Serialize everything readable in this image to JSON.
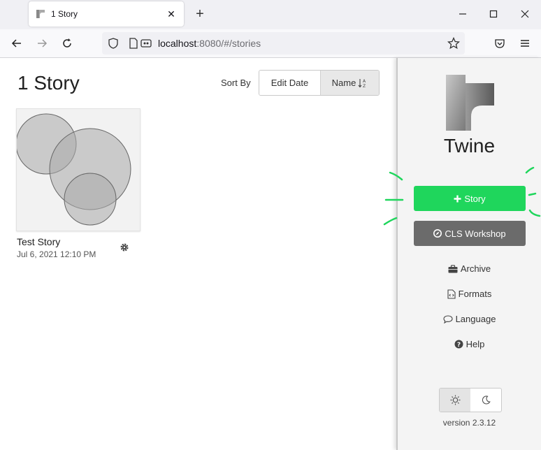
{
  "browser": {
    "tab_title": "1 Story",
    "url_host": "localhost",
    "url_rest": ":8080/#/stories"
  },
  "library": {
    "title": "1 Story",
    "sort_label": "Sort By",
    "sort_options": [
      {
        "label": "Edit Date",
        "active": false
      },
      {
        "label": "Name",
        "active": true
      }
    ]
  },
  "stories": [
    {
      "name": "Test Story",
      "date": "Jul 6, 2021 12:10 PM"
    }
  ],
  "sidebar": {
    "brand": "Twine",
    "new_story_label": "Story",
    "cls_label": "CLS Workshop",
    "links": [
      {
        "label": "Archive",
        "icon": "briefcase-icon"
      },
      {
        "label": "Formats",
        "icon": "file-code-icon"
      },
      {
        "label": "Language",
        "icon": "comment-icon"
      },
      {
        "label": "Help",
        "icon": "question-circle-icon"
      }
    ],
    "version": "version 2.3.12"
  },
  "colors": {
    "accent_green": "#1fd65c",
    "secondary_gray": "#6b6b6b"
  }
}
